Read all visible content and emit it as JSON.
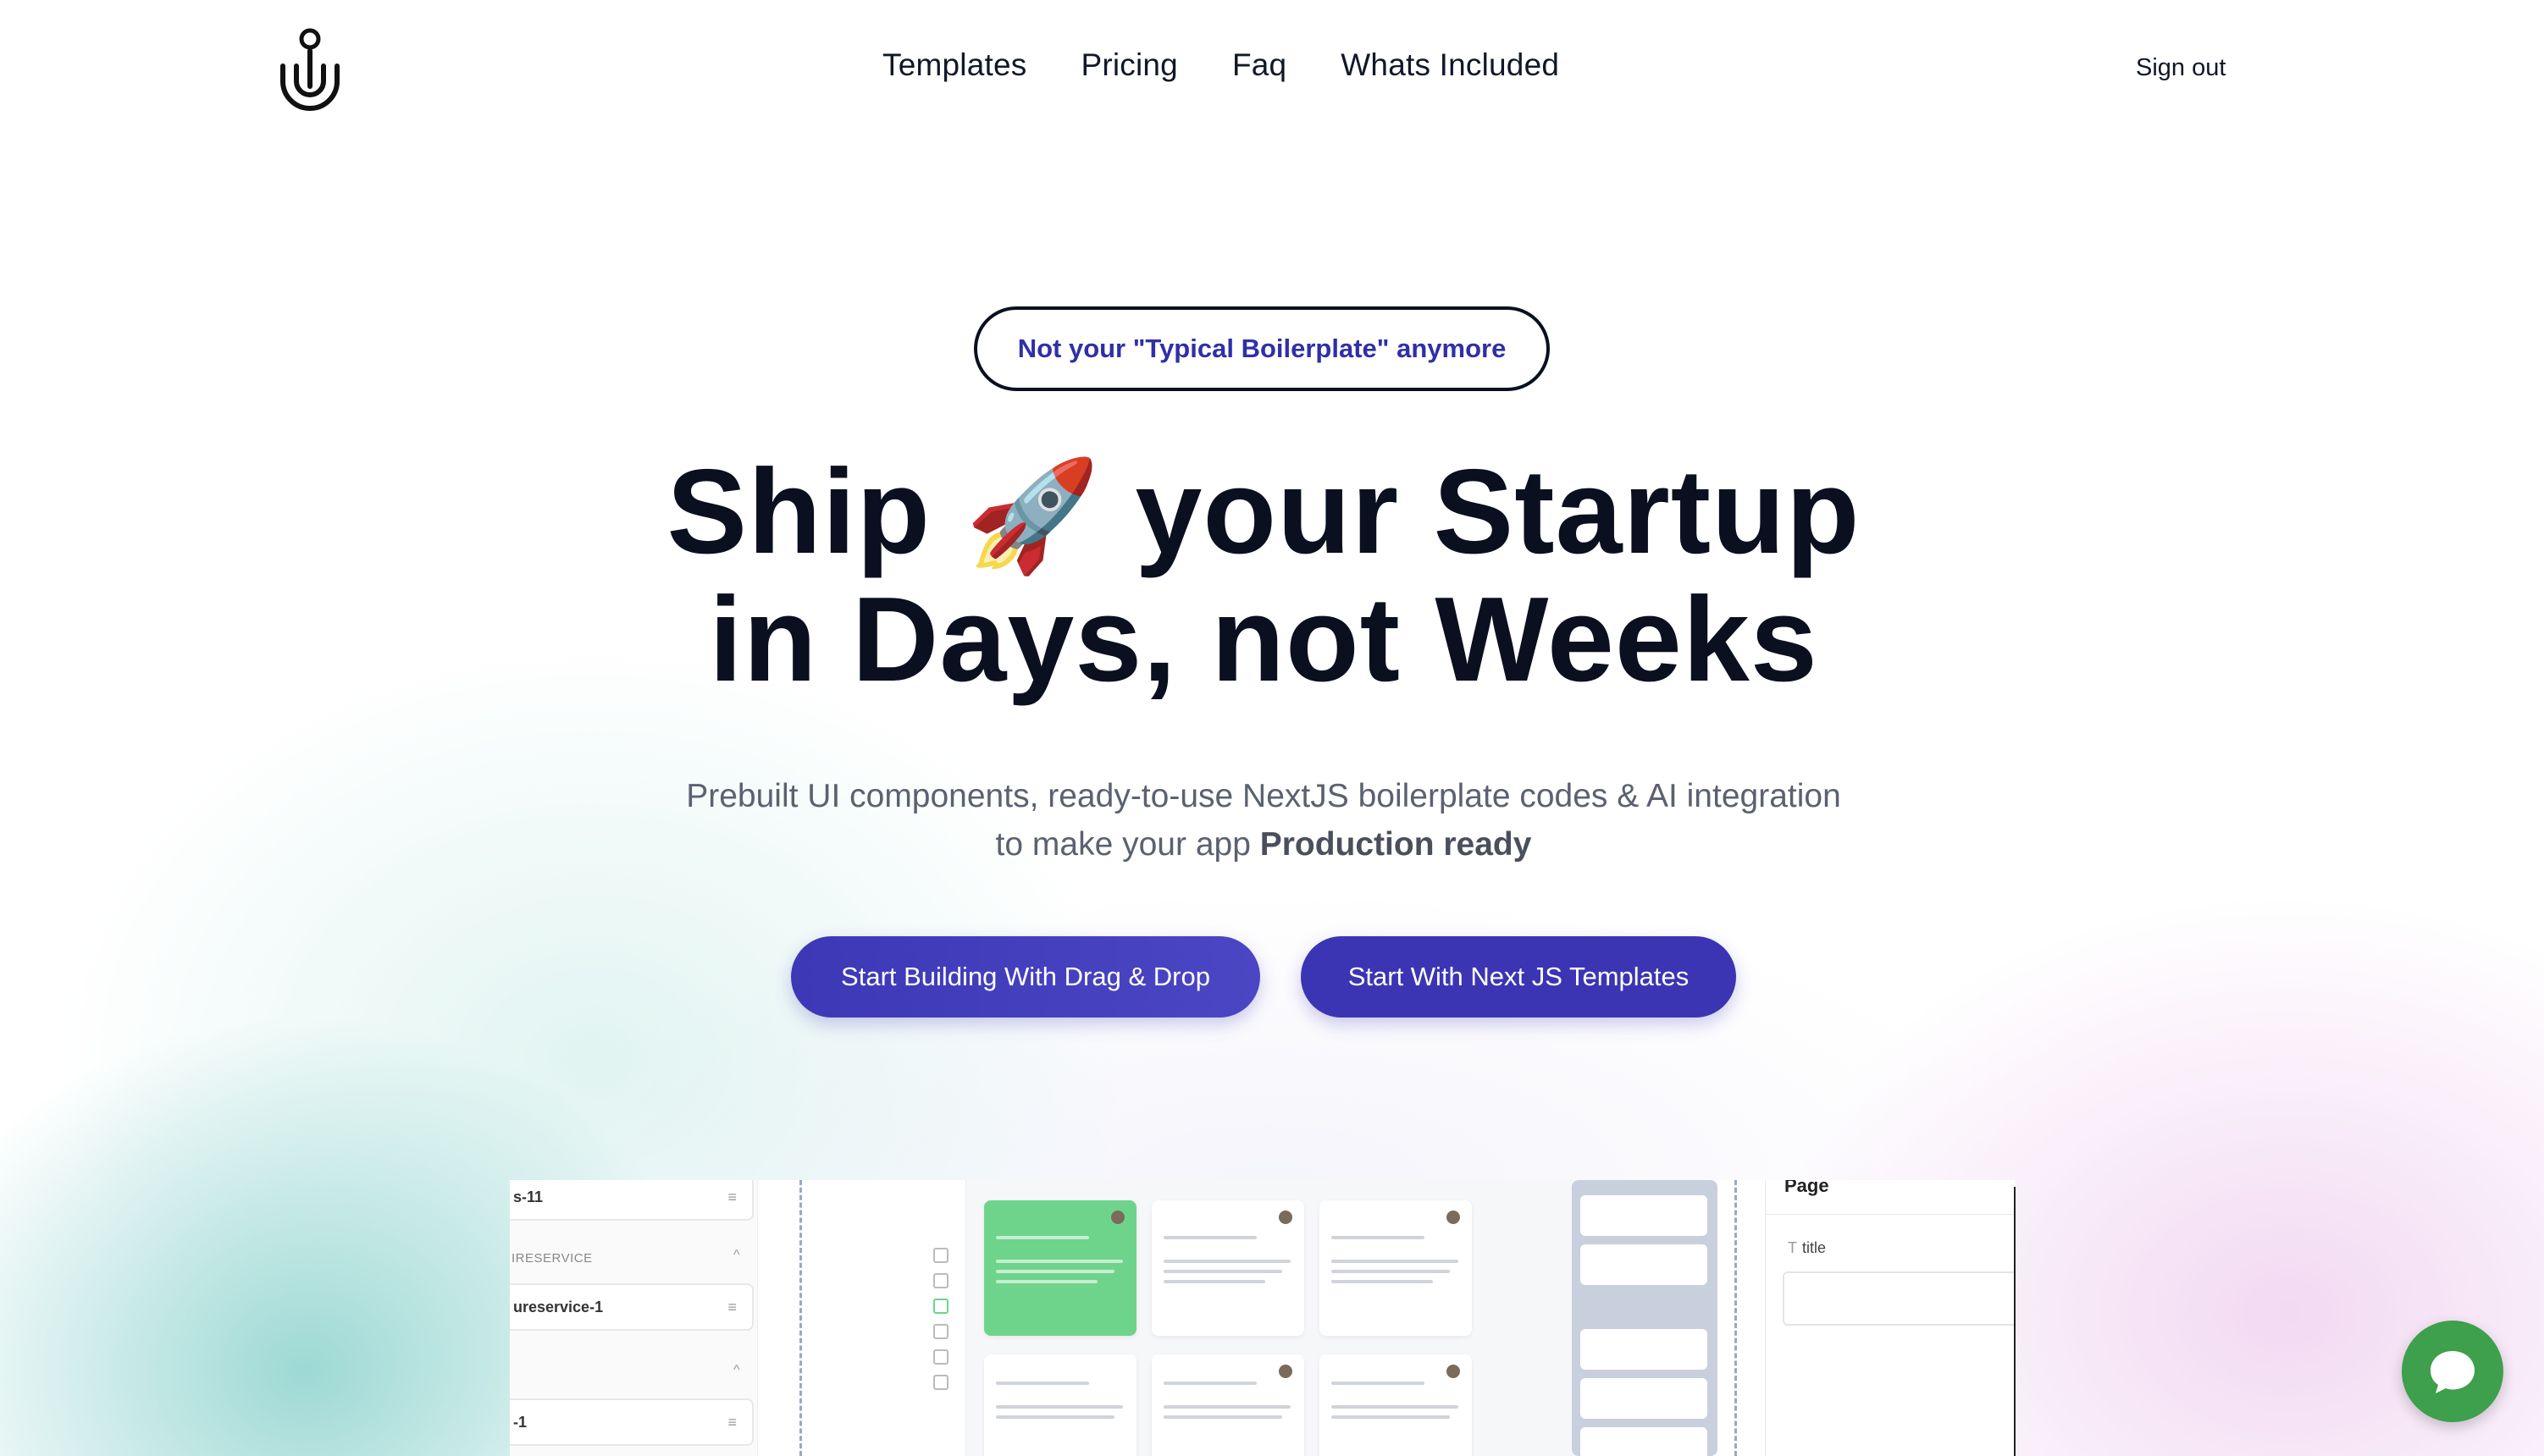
{
  "nav": {
    "logo_icon": "u-magnet-logo",
    "links": [
      {
        "label": "Templates"
      },
      {
        "label": "Pricing"
      },
      {
        "label": "Faq"
      },
      {
        "label": "Whats Included"
      }
    ],
    "sign_out": "Sign out"
  },
  "hero": {
    "badge": "Not your \"Typical Boilerplate\" anymore",
    "headline_part1": "Ship",
    "rocket": "🚀",
    "headline_part2": "your Startup",
    "headline_line2": "in Days, not Weeks",
    "subtitle_line1": "Prebuilt UI components, ready-to-use NextJS boilerplate codes & AI integration",
    "subtitle_line2_prefix": "to make your app ",
    "subtitle_line2_bold": "Production ready",
    "cta_primary": "Start Building With Drag & Drop",
    "cta_secondary": "Start With Next JS Templates"
  },
  "preview": {
    "left_fields": [
      {
        "label": "s-11"
      },
      {
        "label": "ureservice-1"
      },
      {
        "label": "-1"
      }
    ],
    "section_label": "IRESERVICE",
    "right_panel_title": "Page",
    "right_panel_field_label": "title"
  },
  "colors": {
    "accent": "#3b35b4",
    "badge_text": "#2f2fa8",
    "chat_button": "#3e9f4c"
  },
  "chat_icon": "chat-bubble-icon"
}
